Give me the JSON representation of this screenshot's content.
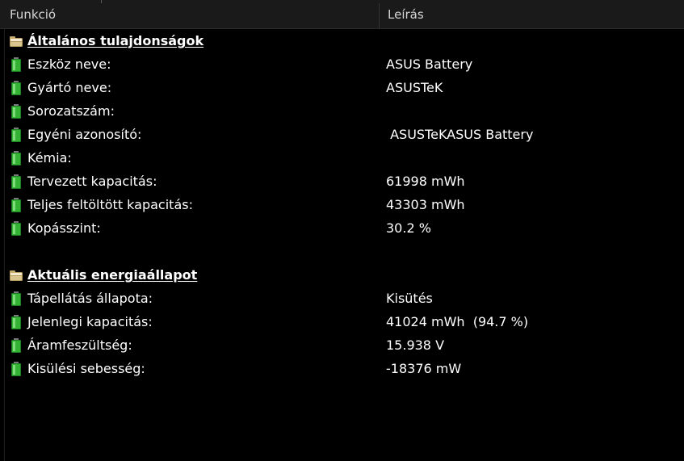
{
  "header": {
    "col_function": "Funkció",
    "col_description": "Leírás"
  },
  "sections": [
    {
      "title": "Általános tulajdonságok",
      "icon": "folder-icon",
      "rows": [
        {
          "label": "Eszköz neve:",
          "value": "ASUS Battery"
        },
        {
          "label": "Gyártó neve:",
          "value": "ASUSTeK"
        },
        {
          "label": "Sorozatszám:",
          "value": ""
        },
        {
          "label": "Egyéni azonosító:",
          "value": " ASUSTeKASUS Battery"
        },
        {
          "label": "Kémia:",
          "value": ""
        },
        {
          "label": "Tervezett kapacitás:",
          "value": "61998 mWh"
        },
        {
          "label": "Teljes feltöltött kapacitás:",
          "value": "43303 mWh"
        },
        {
          "label": "Kopásszint:",
          "value": "30.2 %"
        }
      ]
    },
    {
      "title": "Aktuális energiaállapot",
      "icon": "folder-icon",
      "rows": [
        {
          "label": "Tápellátás állapota:",
          "value": "Kisütés"
        },
        {
          "label": "Jelenlegi kapacitás:",
          "value": "41024 mWh  (94.7 %)"
        },
        {
          "label": "Áramfeszültség:",
          "value": "15.938 V"
        },
        {
          "label": "Kisülési sebesség:",
          "value": "-18376 mW"
        }
      ]
    }
  ],
  "colors": {
    "background": "#000000",
    "header_bg": "#1a1a1a",
    "battery_green": "#34b233"
  }
}
